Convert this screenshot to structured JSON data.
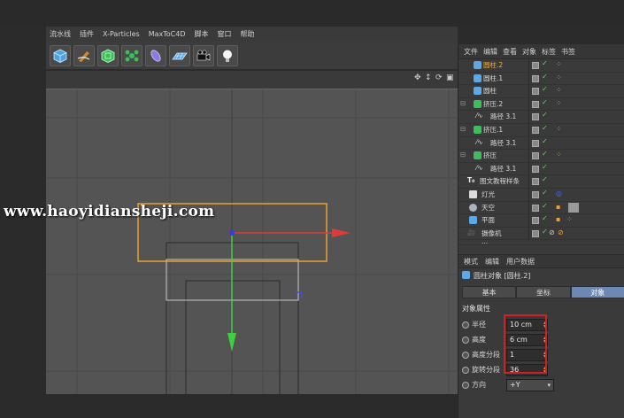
{
  "menu": {
    "items": [
      "流水线",
      "插件",
      "X-Particles",
      "MaxToC4D",
      "脚本",
      "窗口",
      "帮助"
    ]
  },
  "toolbar": {
    "tools": [
      "cube-icon",
      "pen-icon",
      "subdivision-icon",
      "cloner-icon",
      "deformer-icon",
      "floor-icon",
      "camera-icon",
      "light-icon"
    ]
  },
  "watermark": "www.haoyidiansheji.com",
  "object_manager": {
    "menu": [
      "文件",
      "编辑",
      "查看",
      "对象",
      "标签",
      "书签"
    ],
    "objects": [
      {
        "name": "圆柱.2",
        "selected": true,
        "icon": "cylinder"
      },
      {
        "name": "圆柱.1",
        "selected": false,
        "icon": "cylinder"
      },
      {
        "name": "圆柱",
        "selected": false,
        "icon": "cylinder"
      },
      {
        "name": "挤压.2",
        "selected": false,
        "icon": "extrude"
      },
      {
        "name": "路径 3.1",
        "selected": false,
        "icon": "spline"
      },
      {
        "name": "挤压.1",
        "selected": false,
        "icon": "extrude"
      },
      {
        "name": "路径 3.1",
        "selected": false,
        "icon": "spline"
      },
      {
        "name": "挤压",
        "selected": false,
        "icon": "extrude"
      },
      {
        "name": "路径 3.1",
        "selected": false,
        "icon": "spline"
      },
      {
        "name": "图文教程样条",
        "selected": false,
        "icon": "text"
      },
      {
        "name": "灯光",
        "selected": false,
        "icon": "light"
      },
      {
        "name": "天空",
        "selected": false,
        "icon": "sky"
      },
      {
        "name": "平面",
        "selected": false,
        "icon": "plane"
      },
      {
        "name": "摄像机",
        "selected": false,
        "icon": "camera"
      },
      {
        "name": "...",
        "selected": false,
        "icon": "other"
      }
    ]
  },
  "attributes": {
    "menu": [
      "模式",
      "编辑",
      "用户数据"
    ],
    "object_title": "圆柱对象 [圆柱.2]",
    "tabs": [
      "基本",
      "坐标",
      "对象"
    ],
    "active_tab": "对象",
    "section": "对象属性",
    "fields": [
      {
        "label": "半径",
        "value": "10 cm"
      },
      {
        "label": "高度",
        "value": "6 cm"
      },
      {
        "label": "高度分段",
        "value": "1"
      },
      {
        "label": "旋转分段",
        "value": "36"
      }
    ],
    "direction": {
      "label": "方向",
      "value": "+Y"
    }
  },
  "colors": {
    "selection_orange": "#e8a030",
    "highlight_red": "#d02020",
    "axis_x": "#e03a3a",
    "axis_y": "#3ed03e",
    "axis_z": "#3a3ae0",
    "active_tab": "#6d89b3"
  }
}
